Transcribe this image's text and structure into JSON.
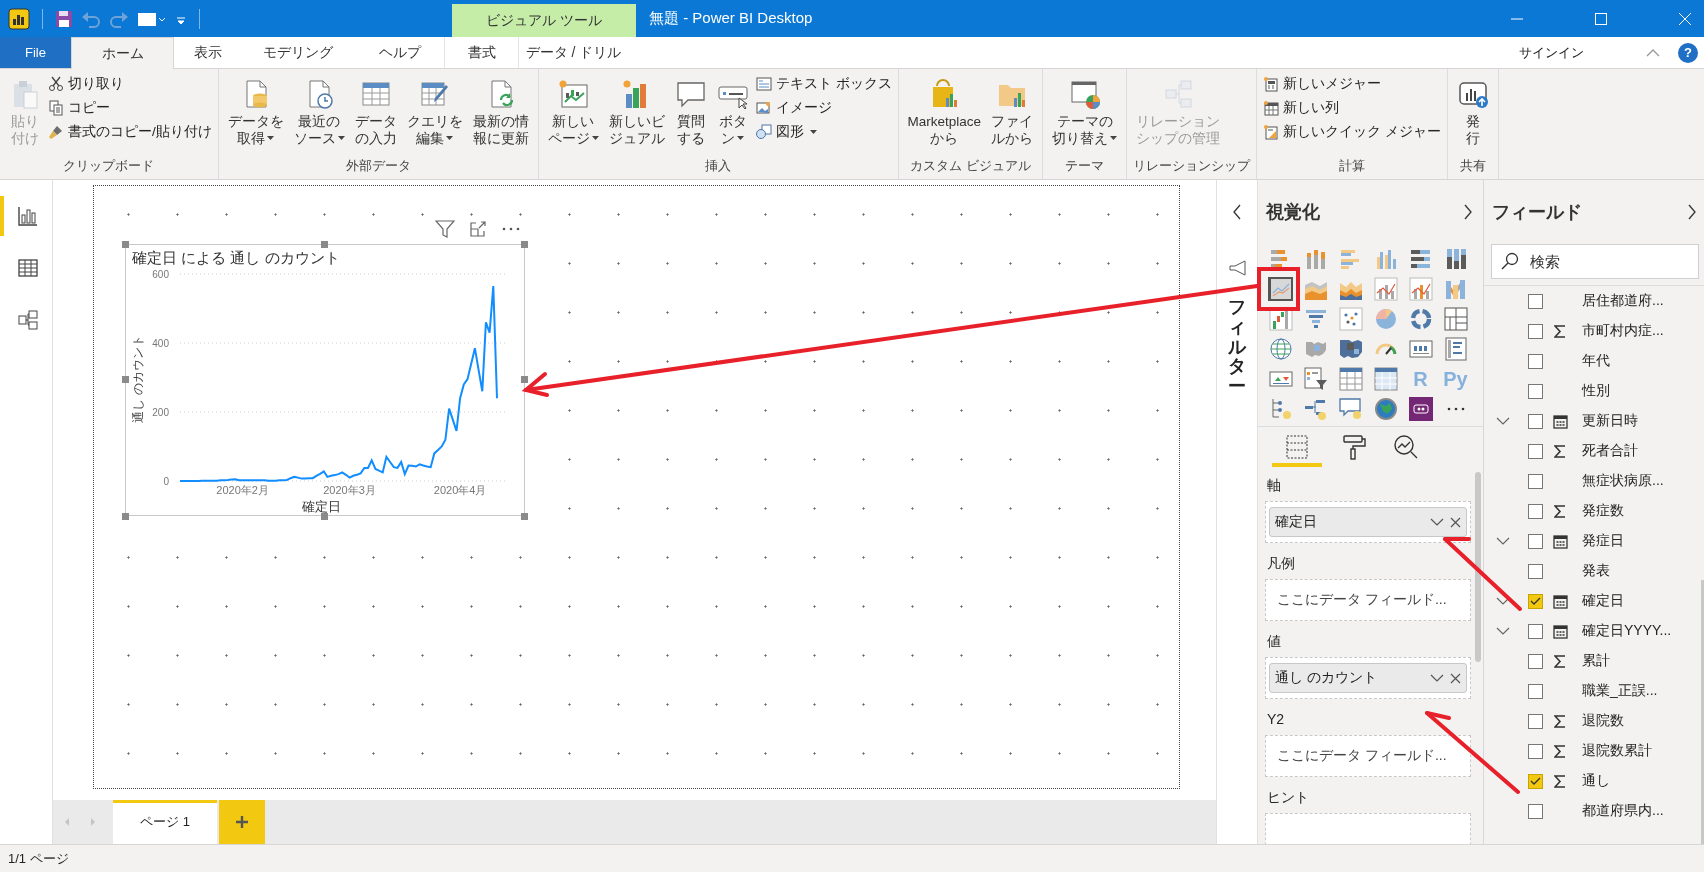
{
  "window": {
    "title": "無題 - Power BI Desktop"
  },
  "contextual_group": {
    "label": "ビジュアル ツール"
  },
  "tabs": [
    {
      "label": "File",
      "kind": "file",
      "selected": false
    },
    {
      "label": "ホーム",
      "kind": "plain",
      "selected": true
    },
    {
      "label": "表示",
      "kind": "plain",
      "selected": false
    },
    {
      "label": "モデリング",
      "kind": "plain",
      "selected": false
    },
    {
      "label": "ヘルプ",
      "kind": "plain",
      "selected": false
    },
    {
      "label": "書式",
      "kind": "contextual",
      "selected": false
    },
    {
      "label": "データ / ドリル",
      "kind": "contextual",
      "selected": false
    }
  ],
  "account": {
    "sign_in": "サインイン",
    "help": "?"
  },
  "ribbon": [
    {
      "label": "クリップボード",
      "items": [
        {
          "kind": "large",
          "lines": [
            "貼り",
            "付け"
          ],
          "dropdown": false,
          "disabled": true
        },
        {
          "kind": "small",
          "label": "切り取り",
          "dropdown": false
        },
        {
          "kind": "small",
          "label": "コピー",
          "dropdown": false
        },
        {
          "kind": "small",
          "label": "書式のコピー/貼り付け",
          "dropdown": false
        }
      ]
    },
    {
      "label": "外部データ",
      "items": [
        {
          "kind": "large",
          "lines": [
            "データを",
            "取得"
          ],
          "dropdown": true,
          "disabled": false
        },
        {
          "kind": "large",
          "lines": [
            "最近の",
            "ソース"
          ],
          "dropdown": true,
          "disabled": false
        },
        {
          "kind": "large",
          "lines": [
            "データ",
            "の入力"
          ],
          "dropdown": false,
          "disabled": false
        },
        {
          "kind": "large",
          "lines": [
            "クエリを",
            "編集"
          ],
          "dropdown": true,
          "disabled": false
        },
        {
          "kind": "large",
          "lines": [
            "最新の情",
            "報に更新"
          ],
          "dropdown": false,
          "disabled": false
        }
      ]
    },
    {
      "label": "挿入",
      "items": [
        {
          "kind": "large",
          "lines": [
            "新しい",
            "ページ"
          ],
          "dropdown": true,
          "disabled": false
        },
        {
          "kind": "large",
          "lines": [
            "新しいビ",
            "ジュアル"
          ],
          "dropdown": false,
          "disabled": false
        },
        {
          "kind": "large",
          "lines": [
            "質問",
            "する"
          ],
          "dropdown": false,
          "disabled": false
        },
        {
          "kind": "large",
          "lines": [
            "ボタ",
            "ン"
          ],
          "dropdown": true,
          "disabled": false
        },
        {
          "kind": "small",
          "label": "テキスト ボックス",
          "dropdown": false
        },
        {
          "kind": "small",
          "label": "イメージ",
          "dropdown": false
        },
        {
          "kind": "small",
          "label": "図形",
          "dropdown": true
        }
      ]
    },
    {
      "label": "カスタム ビジュアル",
      "items": [
        {
          "kind": "large",
          "lines": [
            "Marketplace",
            "から"
          ],
          "dropdown": false,
          "disabled": false
        },
        {
          "kind": "large",
          "lines": [
            "ファイ",
            "ルから"
          ],
          "dropdown": false,
          "disabled": false
        }
      ]
    },
    {
      "label": "テーマ",
      "items": [
        {
          "kind": "large",
          "lines": [
            "テーマの",
            "切り替え"
          ],
          "dropdown": true,
          "disabled": false
        }
      ]
    },
    {
      "label": "リレーションシップ",
      "items": [
        {
          "kind": "large",
          "lines": [
            "リレーション",
            "シップの管理"
          ],
          "dropdown": false,
          "disabled": true
        }
      ]
    },
    {
      "label": "計算",
      "items": [
        {
          "kind": "small",
          "label": "新しいメジャー",
          "dropdown": false
        },
        {
          "kind": "small",
          "label": "新しい列",
          "dropdown": false
        },
        {
          "kind": "small",
          "label": "新しいクイック メジャー",
          "dropdown": false
        }
      ]
    },
    {
      "label": "共有",
      "items": [
        {
          "kind": "large",
          "lines": [
            "発",
            "行"
          ],
          "dropdown": false,
          "disabled": false
        }
      ]
    }
  ],
  "views": [
    {
      "selected": true
    },
    {
      "selected": false
    },
    {
      "selected": false
    }
  ],
  "visual": {
    "chart_data": {
      "type": "line",
      "title": "確定日 による 通し のカウント",
      "xlabel": "確定日",
      "ylabel": "通し のカウント",
      "categories": [
        null,
        null,
        null,
        null,
        null,
        null,
        null,
        null,
        null,
        null,
        null,
        null,
        null,
        null,
        null,
        null,
        null,
        "2020年2月",
        null,
        null,
        null,
        null,
        null,
        null,
        null,
        null,
        null,
        null,
        null,
        null,
        null,
        null,
        null,
        null,
        null,
        null,
        null,
        null,
        null,
        null,
        null,
        null,
        null,
        null,
        null,
        null,
        "2020年3月",
        null,
        null,
        null,
        null,
        null,
        null,
        null,
        null,
        null,
        null,
        null,
        null,
        null,
        null,
        null,
        null,
        null,
        null,
        null,
        null,
        null,
        null,
        null,
        null,
        null,
        null,
        null,
        null,
        null,
        "2020年4月",
        null,
        null,
        null,
        null,
        null,
        null,
        null,
        null,
        null,
        null
      ],
      "values": [
        0,
        0,
        0,
        0,
        0,
        0,
        1,
        1,
        1,
        1,
        1,
        2,
        2,
        3,
        4,
        5,
        2,
        2,
        2,
        2,
        2,
        2,
        2,
        2,
        1,
        1,
        1,
        2,
        2,
        3,
        8,
        12,
        10,
        7,
        7,
        8,
        8,
        15,
        21,
        28,
        12,
        15,
        17,
        20,
        25,
        18,
        10,
        15,
        18,
        22,
        38,
        38,
        60,
        35,
        30,
        25,
        70,
        55,
        40,
        38,
        55,
        20,
        45,
        44,
        42,
        48,
        45,
        42,
        40,
        80,
        90,
        100,
        120,
        210,
        178,
        145,
        240,
        280,
        295,
        340,
        385,
        322,
        260,
        460,
        430,
        565,
        240
      ],
      "ylim": [
        0,
        600
      ],
      "yticks": [
        0,
        200,
        400,
        600
      ]
    }
  },
  "page_tabs": [
    {
      "label": "ページ 1",
      "selected": true
    }
  ],
  "filters_pane": {
    "label": "フィルター"
  },
  "visualizations": {
    "title": "視覚化",
    "types": [
      {
        "selected": false
      },
      {
        "selected": false
      },
      {
        "selected": false
      },
      {
        "selected": false
      },
      {
        "selected": false
      },
      {
        "selected": false
      },
      {
        "selected": true
      },
      {
        "selected": false
      },
      {
        "selected": false
      },
      {
        "selected": false
      },
      {
        "selected": false
      },
      {
        "selected": false
      },
      {
        "selected": false
      },
      {
        "selected": false
      },
      {
        "selected": false
      },
      {
        "selected": false
      },
      {
        "selected": false
      },
      {
        "selected": false
      },
      {
        "selected": false
      },
      {
        "selected": false
      },
      {
        "selected": false
      },
      {
        "selected": false
      },
      {
        "selected": false
      },
      {
        "selected": false
      },
      {
        "selected": false
      },
      {
        "selected": false
      },
      {
        "selected": false
      },
      {
        "selected": false
      },
      {
        "selected": false,
        "label": "R"
      },
      {
        "selected": false,
        "label": "Py"
      },
      {
        "selected": false
      },
      {
        "selected": false
      },
      {
        "selected": false
      },
      {
        "selected": false
      },
      {
        "selected": false
      }
    ],
    "pane_tabs": [
      {
        "selected": true
      },
      {
        "selected": false
      },
      {
        "selected": false
      }
    ],
    "wells": [
      {
        "label": "軸",
        "field": "確定日"
      },
      {
        "label": "凡例",
        "placeholder": "ここにデータ フィールド..."
      },
      {
        "label": "値",
        "field": "通し のカウント"
      },
      {
        "label": "Y2",
        "placeholder": "ここにデータ フィールド..."
      },
      {
        "label": "ヒント"
      }
    ]
  },
  "fields": {
    "title": "フィールド",
    "search": {
      "placeholder": "検索"
    },
    "items": [
      {
        "label": "居住都道府...",
        "kind": "text",
        "checked": false,
        "hierarchy": false
      },
      {
        "label": "市町村内症...",
        "kind": "measure",
        "checked": false,
        "hierarchy": false
      },
      {
        "label": "年代",
        "kind": "text",
        "checked": false,
        "hierarchy": false
      },
      {
        "label": "性別",
        "kind": "text",
        "checked": false,
        "hierarchy": false
      },
      {
        "label": "更新日時",
        "kind": "date",
        "checked": false,
        "hierarchy": true
      },
      {
        "label": "死者合計",
        "kind": "measure",
        "checked": false,
        "hierarchy": false
      },
      {
        "label": "無症状病原...",
        "kind": "text",
        "checked": false,
        "hierarchy": false
      },
      {
        "label": "発症数",
        "kind": "measure",
        "checked": false,
        "hierarchy": false
      },
      {
        "label": "発症日",
        "kind": "date",
        "checked": false,
        "hierarchy": true
      },
      {
        "label": "発表",
        "kind": "text",
        "checked": false,
        "hierarchy": false
      },
      {
        "label": "確定日",
        "kind": "date",
        "checked": true,
        "hierarchy": true
      },
      {
        "label": "確定日YYYY...",
        "kind": "date",
        "checked": false,
        "hierarchy": true
      },
      {
        "label": "累計",
        "kind": "measure",
        "checked": false,
        "hierarchy": false
      },
      {
        "label": "職業_正誤...",
        "kind": "text",
        "checked": false,
        "hierarchy": false
      },
      {
        "label": "退院数",
        "kind": "measure",
        "checked": false,
        "hierarchy": false
      },
      {
        "label": "退院数累計",
        "kind": "measure",
        "checked": false,
        "hierarchy": false
      },
      {
        "label": "通し",
        "kind": "measure",
        "checked": true,
        "hierarchy": false
      },
      {
        "label": "都道府県内...",
        "kind": "text",
        "checked": false,
        "hierarchy": false
      }
    ]
  },
  "status_bar": {
    "text": "1/1 ページ"
  }
}
